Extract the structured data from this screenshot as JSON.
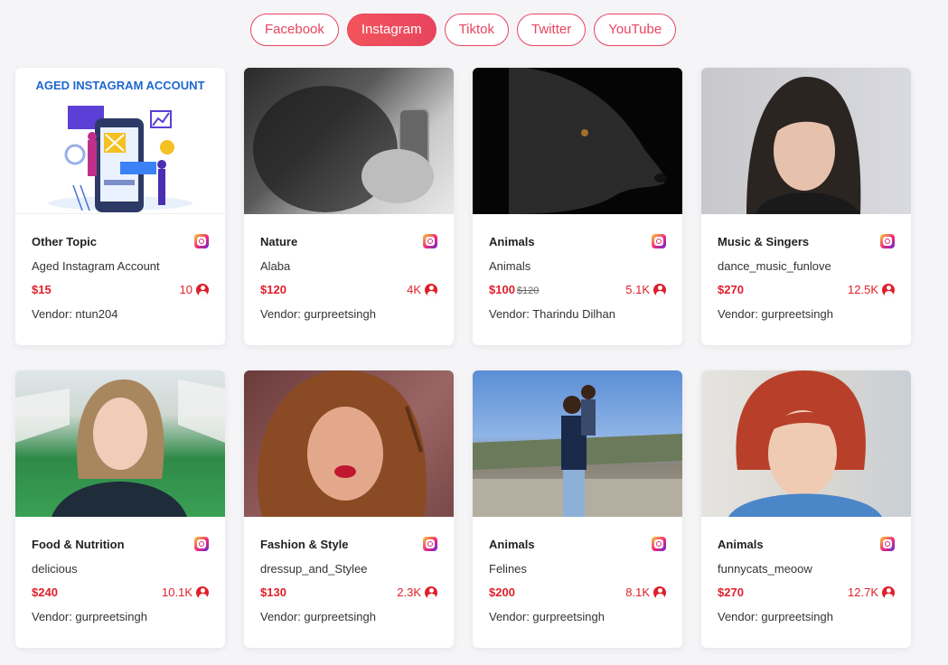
{
  "tabs": [
    {
      "label": "Facebook",
      "active": false
    },
    {
      "label": "Instagram",
      "active": true
    },
    {
      "label": "Tiktok",
      "active": false
    },
    {
      "label": "Twitter",
      "active": false
    },
    {
      "label": "YouTube",
      "active": false
    }
  ],
  "colors": {
    "accent": "#e8445f",
    "price": "#e01e2a"
  },
  "cards": [
    {
      "category": "Other Topic",
      "name": "Aged Instagram Account",
      "price": "$15",
      "old_price": "",
      "followers": "10",
      "vendor": "Vendor: ntun204",
      "image": "aged-instagram-account-illustration",
      "image_text": "AGED INSTAGRAM ACCOUNT"
    },
    {
      "category": "Nature",
      "name": "Alaba",
      "price": "$120",
      "old_price": "",
      "followers": "4K",
      "vendor": "Vendor: gurpreetsingh",
      "image": "bw-phone-selfie-photo"
    },
    {
      "category": "Animals",
      "name": "Animals",
      "price": "$100",
      "old_price": "$120",
      "followers": "5.1K",
      "vendor": "Vendor: Tharindu Dilhan",
      "image": "black-dog-photo"
    },
    {
      "category": "Music & Singers",
      "name": "dance_music_funlove",
      "price": "$270",
      "old_price": "",
      "followers": "12.5K",
      "vendor": "Vendor: gurpreetsingh",
      "image": "person-portrait-photo"
    },
    {
      "category": "Food & Nutrition",
      "name": "delicious",
      "price": "$240",
      "old_price": "",
      "followers": "10.1K",
      "vendor": "Vendor: gurpreetsingh",
      "image": "woman-selfie-photo"
    },
    {
      "category": "Fashion & Style",
      "name": "dressup_and_Stylee",
      "price": "$130",
      "old_price": "",
      "followers": "2.3K",
      "vendor": "Vendor: gurpreetsingh",
      "image": "curly-hair-woman-photo"
    },
    {
      "category": "Animals",
      "name": "Felines",
      "price": "$200",
      "old_price": "",
      "followers": "8.1K",
      "vendor": "Vendor: gurpreetsingh",
      "image": "mother-child-photo"
    },
    {
      "category": "Animals",
      "name": "funnycats_meoow",
      "price": "$270",
      "old_price": "",
      "followers": "12.7K",
      "vendor": "Vendor: gurpreetsingh",
      "image": "red-hair-woman-photo"
    }
  ]
}
